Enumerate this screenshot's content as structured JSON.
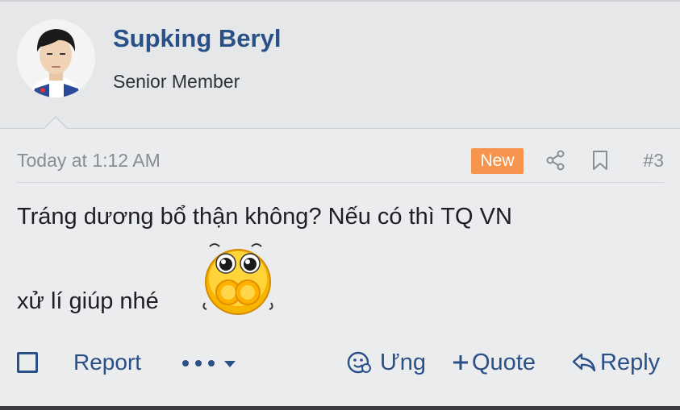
{
  "user": {
    "name": "Supking Beryl",
    "title": "Senior Member"
  },
  "post": {
    "time": "Today at 1:12 AM",
    "badge": "New",
    "number": "#3",
    "message_line1": "Tráng dương bổ thận không? Nếu có thì TQ VN",
    "message_line2": "xử lí giúp nhé"
  },
  "actions": {
    "report": "Report",
    "react": "Ưng",
    "quote": "Quote",
    "reply": "Reply"
  },
  "icons": {
    "avatar": "user-avatar-photo",
    "share": "share-icon",
    "bookmark": "bookmark-icon",
    "checkbox": "select-checkbox",
    "more": "more-options-icon",
    "react": "smiley-react-icon",
    "quote": "plus-icon",
    "reply": "reply-arrow-icon",
    "emoji": "blushing-emoji"
  },
  "colors": {
    "link": "#2a5088",
    "badge": "#f7954e",
    "muted": "#8a8d92",
    "text": "#1d1f22"
  }
}
